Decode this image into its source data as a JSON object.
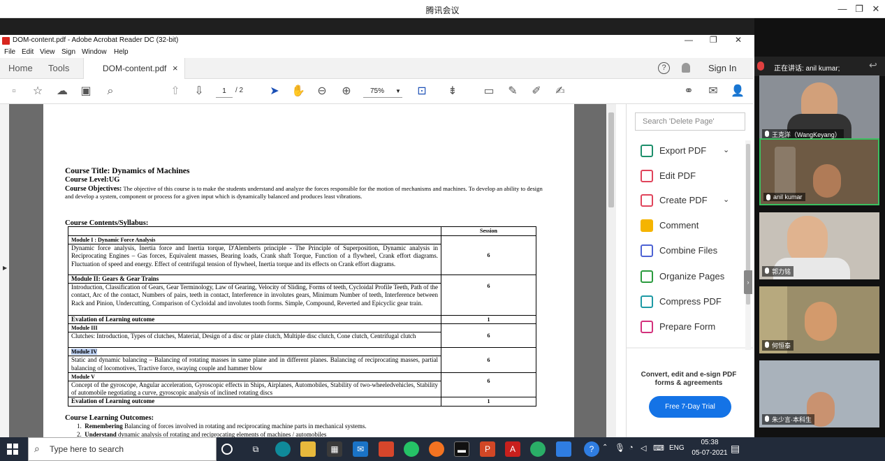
{
  "meeting": {
    "title": "腾讯会议",
    "minimize": "—",
    "restore": "❐",
    "close": "✕",
    "speaking_label": "正在讲话: anil kumar;",
    "participants": [
      {
        "name": "王克洋（WangKeyang）",
        "bg": "#8a8f96"
      },
      {
        "name": "anil kumar",
        "bg": "#6e5a44"
      },
      {
        "name": "郭力铭",
        "bg": "#c7c1b8"
      },
      {
        "name": "何恒泰",
        "bg": "#9b8e6a"
      },
      {
        "name": "朱少言·本科生",
        "bg": "#a9b2bb"
      }
    ]
  },
  "acrobat": {
    "window_title": "DOM-content.pdf - Adobe Acrobat Reader DC (32-bit)",
    "win_min": "—",
    "win_restore": "❐",
    "win_close": "✕",
    "menu": [
      "File",
      "Edit",
      "View",
      "Sign",
      "Window",
      "Help"
    ],
    "tabs": {
      "home": "Home",
      "tools": "Tools",
      "doc": "DOM-content.pdf",
      "doc_close": "×"
    },
    "help": "?",
    "sign_in": "Sign In",
    "page_current": "1",
    "page_total": "/ 2",
    "zoom": "75%"
  },
  "document": {
    "course_title": "Course Title: Dynamics of Machines",
    "course_level": "Course Level:UG",
    "objectives_label": "Course Objectives:",
    "objectives_text": " The objective of this course is to make the students understand and analyze the forces responsible for the motion of mechanisms and machines. To develop an ability to design and develop a system, component or process for a given input which is dynamically balanced and produces least vibrations.",
    "syllabus_heading": "Course Contents/Syllabus:",
    "session_header": "Session",
    "modules": [
      {
        "title": "Module I : Dynamic Force Analysis",
        "text": "Dynamic force analysis, Inertia force and Inertia torque, D'Alemberts principle - The Principle of Superposition, Dynamic analysis in Reciprocating Engines – Gas forces, Equivalent masses, Bearing loads, Crank shaft Torque, Function of a flywheel, Crank effort diagrams.  Fluctuation of speed and energy. Effect of centrifugal tension of flywheel, Inertia torque and its effects on Crank effort diagrams.",
        "session": "6"
      },
      {
        "title": "Module II: Gears & Gear Trains",
        "text": "Introduction, Classification of Gears, Gear Terminology, Law of Gearing, Velocity of Sliding, Forms of teeth, Cycloidal Profile Teeth, Path of the contact, Arc of the contact, Numbers of pairs, teeth in contact, Interference in involutes gears, Minimum Number of teeth, Interference between Rack and Pinion, Undercutting, Comparison of Cycloidal and involutes tooth forms. Simple, Compound, Reverted and Epicyclic gear train.",
        "session": "6"
      },
      {
        "title": "Evalation of Learning outcome",
        "text": "",
        "session": "1"
      },
      {
        "title": "Module III",
        "text": "Clutches: Introduction, Types of clutches, Material, Design of a disc or plate clutch, Multiple disc clutch, Cone clutch, Centrifugal clutch",
        "session": "6"
      },
      {
        "title": "Module IV",
        "text": "Static and dynamic balancing – Balancing of rotating masses in same plane and in different planes. Balancing of reciprocating masses, partial balancing of locomotives, Tractive force, swaying couple and hammer blow",
        "session": "6"
      },
      {
        "title": "Module V",
        "text": "Concept of the gyroscope, Angular acceleration, Gyroscopic effects in Ships, Airplanes, Automobiles, Stability of two-wheeledvehicles, Stability of automobile negotiating a curve, gyroscopic analysis of inclined rotating discs",
        "session": "6"
      },
      {
        "title": "Evalation of Learning outcome",
        "text": "",
        "session": "1"
      }
    ],
    "outcomes_heading": "Course Learning Outcomes:",
    "outcome_1_num": "1.",
    "outcome_1_bold": "Remembering",
    "outcome_1_text": " Balancing of forces involved in rotating and reciprocating machine parts in mechanical systems.",
    "outcome_2_num": "2.",
    "outcome_2_bold": "Understand",
    "outcome_2_text": " dynamic analysis of rotating and reciprocating elements of machines / automobiles"
  },
  "tools_pane": {
    "search_placeholder": "Search 'Delete Page'",
    "items": [
      {
        "label": "Export PDF",
        "color": "#1d8f6b"
      },
      {
        "label": "Edit PDF",
        "color": "#e0445b"
      },
      {
        "label": "Create PDF",
        "color": "#e0445b"
      },
      {
        "label": "Comment",
        "color": "#f5b400"
      },
      {
        "label": "Combine Files",
        "color": "#4e63d4"
      },
      {
        "label": "Organize Pages",
        "color": "#2b9b3e"
      },
      {
        "label": "Compress PDF",
        "color": "#1e9aa5"
      },
      {
        "label": "Prepare Form",
        "color": "#d3317c"
      }
    ],
    "promo": "Convert, edit and e-sign PDF forms & agreements",
    "trial_button": "Free 7-Day Trial"
  },
  "taskbar": {
    "search_placeholder": "Type here to search",
    "lang": "ENG",
    "time": "05:38",
    "date": "05-07-2021"
  }
}
